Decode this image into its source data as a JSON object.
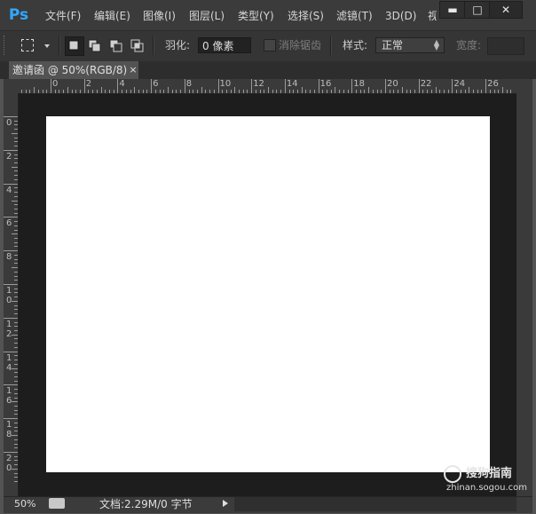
{
  "app": {
    "logo_text": "Ps"
  },
  "menubar": {
    "items": [
      "文件(F)",
      "编辑(E)",
      "图像(I)",
      "图层(L)",
      "类型(Y)",
      "选择(S)",
      "滤镜(T)",
      "3D(D)",
      "视"
    ]
  },
  "window_controls": {
    "minimize": "▬",
    "maximize": "□",
    "close": "✕"
  },
  "options_bar": {
    "feather_label": "羽化:",
    "feather_value": "0 像素",
    "anti_alias_label": "消除锯齿",
    "style_label": "样式:",
    "style_value": "正常",
    "width_label": "宽度:"
  },
  "document": {
    "tab_title": "邀请函 @ 50%(RGB/8)",
    "tab_close": "×"
  },
  "rulers": {
    "horizontal": [
      "0",
      "2",
      "4",
      "6",
      "8",
      "10",
      "12",
      "14",
      "16",
      "18",
      "20",
      "22",
      "24",
      "26"
    ],
    "vertical": [
      [
        "0"
      ],
      [
        "2"
      ],
      [
        "4"
      ],
      [
        "6"
      ],
      [
        "8"
      ],
      [
        "1",
        "0"
      ],
      [
        "1",
        "2"
      ],
      [
        "1",
        "4"
      ],
      [
        "1",
        "6"
      ],
      [
        "1",
        "8"
      ],
      [
        "2",
        "0"
      ]
    ]
  },
  "statusbar": {
    "zoom": "50%",
    "doc_info": "文档:2.29M/0 字节"
  },
  "watermark": {
    "title": "搜狗指南",
    "url": "zhinan.sogou.com"
  }
}
